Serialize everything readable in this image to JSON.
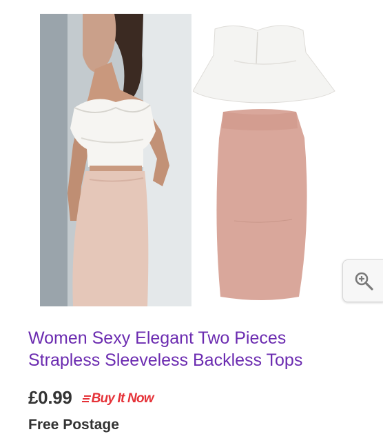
{
  "listing": {
    "title_line1": "Women Sexy Elegant Two Pieces",
    "title_line2": "Strapless Sleeveless Backless Tops",
    "price": "£0.99",
    "buy_now_label": "Buy It Now",
    "postage": "Free Postage"
  },
  "icons": {
    "zoom": "zoom-in-icon",
    "buy_now_lines": "buy-now-speed-lines-icon"
  },
  "colors": {
    "title_link": "#6b2bb0",
    "price_text": "#333333",
    "buy_now": "#e53238",
    "skirt": "#d9a79b",
    "top": "#f4f4f2"
  }
}
